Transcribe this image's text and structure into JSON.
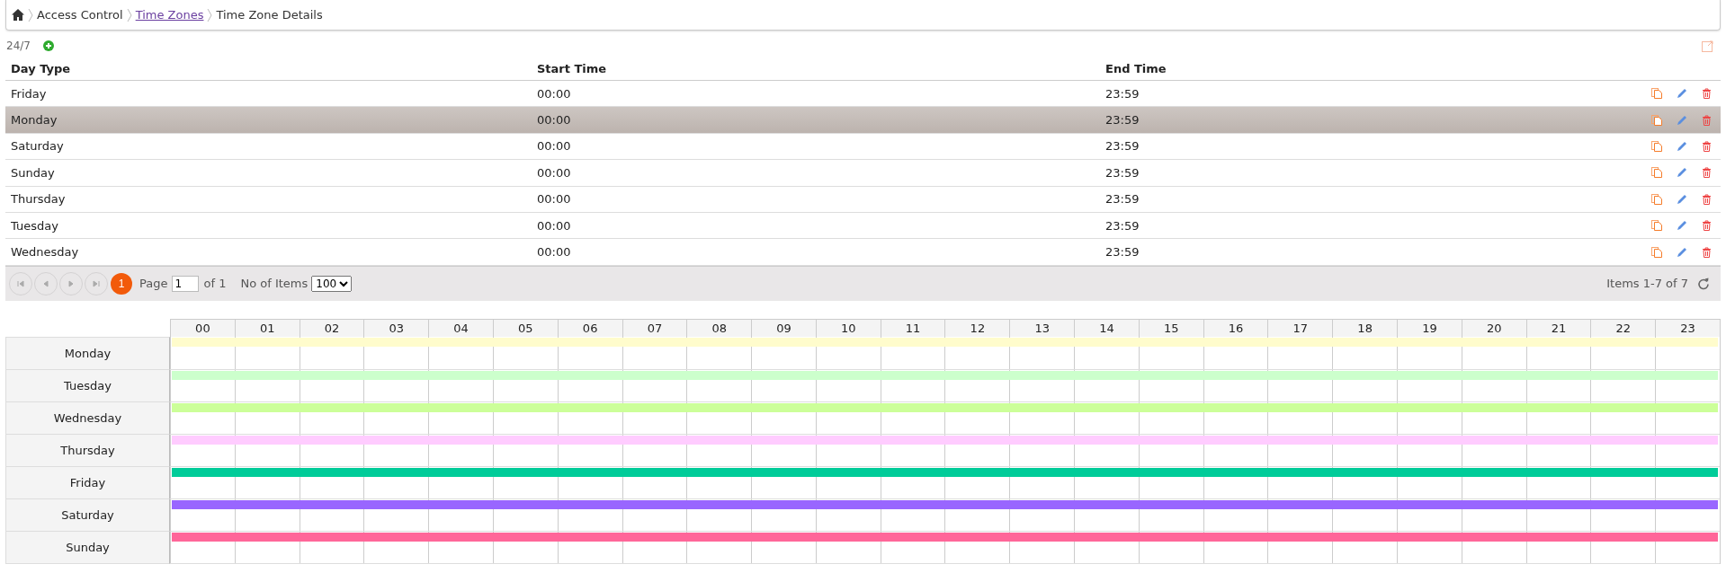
{
  "breadcrumb": {
    "items": [
      {
        "label": "Access Control",
        "link": false
      },
      {
        "label": "Time Zones",
        "link": true
      },
      {
        "label": "Time Zone Details",
        "link": false
      }
    ]
  },
  "time_zone": {
    "title": "24/7"
  },
  "table": {
    "columns": [
      "Day Type",
      "Start Time",
      "End Time"
    ],
    "rows": [
      {
        "cells": [
          "Friday",
          "00:00",
          "23:59"
        ],
        "selected": false
      },
      {
        "cells": [
          "Monday",
          "00:00",
          "23:59"
        ],
        "selected": true
      },
      {
        "cells": [
          "Saturday",
          "00:00",
          "23:59"
        ],
        "selected": false
      },
      {
        "cells": [
          "Sunday",
          "00:00",
          "23:59"
        ],
        "selected": false
      },
      {
        "cells": [
          "Thursday",
          "00:00",
          "23:59"
        ],
        "selected": false
      },
      {
        "cells": [
          "Tuesday",
          "00:00",
          "23:59"
        ],
        "selected": false
      },
      {
        "cells": [
          "Wednesday",
          "00:00",
          "23:59"
        ],
        "selected": false
      }
    ]
  },
  "pager": {
    "nav_buttons": [
      {
        "kind": "first",
        "disabled": true
      },
      {
        "kind": "prev",
        "disabled": true
      },
      {
        "kind": "next",
        "disabled": true
      },
      {
        "kind": "last",
        "disabled": true
      }
    ],
    "pages": [
      {
        "label": "1",
        "selected": true
      }
    ],
    "page_label": "Page",
    "page_value": "1",
    "of_label": "of 1",
    "items_label": "No of Items",
    "items_value": "100",
    "summary": "Items 1-7 of 7"
  },
  "schedule": {
    "hours": [
      "00",
      "01",
      "02",
      "03",
      "04",
      "05",
      "06",
      "07",
      "08",
      "09",
      "10",
      "11",
      "12",
      "13",
      "14",
      "15",
      "16",
      "17",
      "18",
      "19",
      "20",
      "21",
      "22",
      "23"
    ],
    "days": [
      {
        "label": "Monday",
        "color": "#fffccc"
      },
      {
        "label": "Tuesday",
        "color": "#ccffcc"
      },
      {
        "label": "Wednesday",
        "color": "#ccff99"
      },
      {
        "label": "Thursday",
        "color": "#ffccff"
      },
      {
        "label": "Friday",
        "color": "#00cc99"
      },
      {
        "label": "Saturday",
        "color": "#9966ff"
      },
      {
        "label": "Sunday",
        "color": "#ff6699"
      }
    ]
  }
}
